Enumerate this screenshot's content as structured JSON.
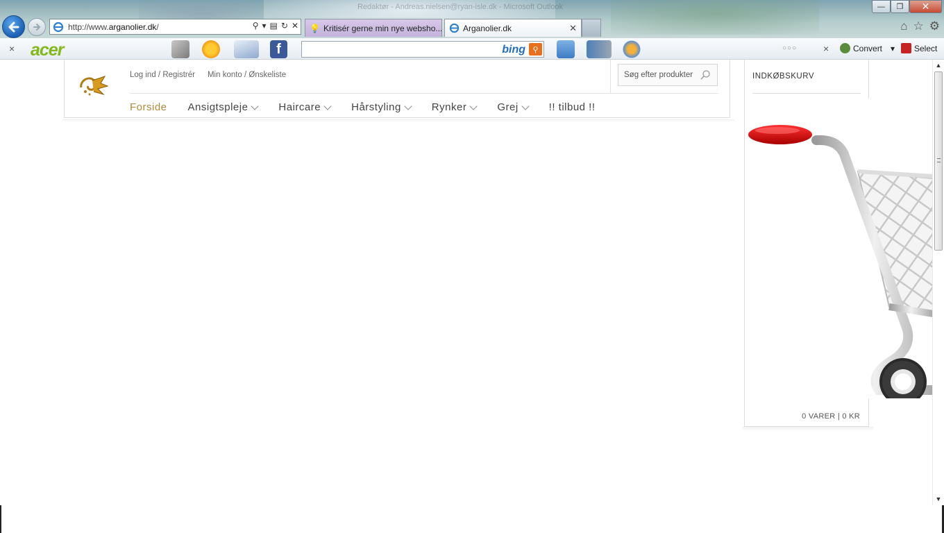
{
  "window": {
    "title": "Redaktør - Andreas.nielsen@ryan-isle.dk - Microsoft Outlook",
    "controls": {
      "minimize": "—",
      "maximize": "❐",
      "close": "✕"
    }
  },
  "browser": {
    "address": {
      "prefix": "http://www.",
      "domain": "arganolier.dk",
      "suffix": "/"
    },
    "tabs": [
      {
        "label": "Kritisér gerne min nye websho...",
        "active": false
      },
      {
        "label": "Arganolier.dk",
        "active": true
      }
    ],
    "tab_close": "✕",
    "right_icons": [
      "home-icon",
      "favorites-star-icon",
      "settings-gear-icon"
    ]
  },
  "toolbar": {
    "close": "×",
    "brand": "acer",
    "search_placeholder": "",
    "bing_label": "bing",
    "dots": "○○○",
    "close2": "×",
    "convert_label": "Convert",
    "select_label": "Select"
  },
  "site": {
    "toplinks": {
      "login": "Log ind / Registrér",
      "account": "Min konto / Ønskeliste"
    },
    "search_placeholder": "Søg efter produkter",
    "nav": [
      {
        "label": "Forside",
        "current": true,
        "dropdown": false
      },
      {
        "label": "Ansigtspleje",
        "current": false,
        "dropdown": true
      },
      {
        "label": "Haircare",
        "current": false,
        "dropdown": true
      },
      {
        "label": "Hårstyling",
        "current": false,
        "dropdown": true
      },
      {
        "label": "Rynker",
        "current": false,
        "dropdown": true
      },
      {
        "label": "Grej",
        "current": false,
        "dropdown": true
      },
      {
        "label": "!! tilbud !!",
        "current": false,
        "dropdown": false
      }
    ],
    "cart": {
      "title": "INDKØBSKURV",
      "summary": "0 VARER | 0 KR"
    }
  },
  "colors": {
    "accent_nav": "#b18a3a",
    "acer_green": "#83b81a",
    "bing_orange": "#e96f1c",
    "cart_handle": "#c81010"
  }
}
